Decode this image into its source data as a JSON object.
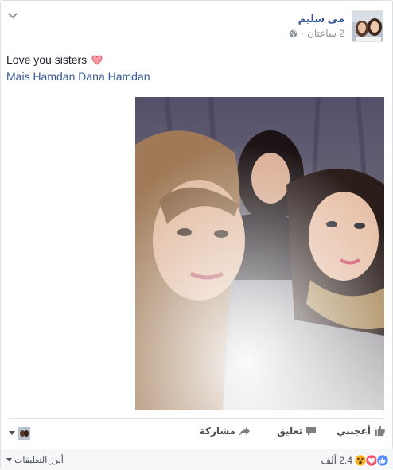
{
  "post": {
    "author": "مى سليم",
    "time": "2 ساعتان",
    "separator": "·",
    "text": "Love you sisters",
    "tags": "Mais Hamdan Dana Hamdan"
  },
  "actions": {
    "like": "أعجبني",
    "comment": "تعليق",
    "share": "مشاركة"
  },
  "footer": {
    "sort_label": "أبرز التعليقات",
    "reactions_count": "2.4 ألف"
  },
  "icons": {
    "audience": "globe-icon",
    "heart": "heart-emoji-icon",
    "reactions": [
      "like-reaction-icon",
      "love-reaction-icon",
      "wow-reaction-icon"
    ]
  },
  "colors": {
    "link": "#365899",
    "muted": "#90949c",
    "like_blue": "#5890ff",
    "love_red": "#f25268",
    "wow_yellow": "#f7b125"
  }
}
